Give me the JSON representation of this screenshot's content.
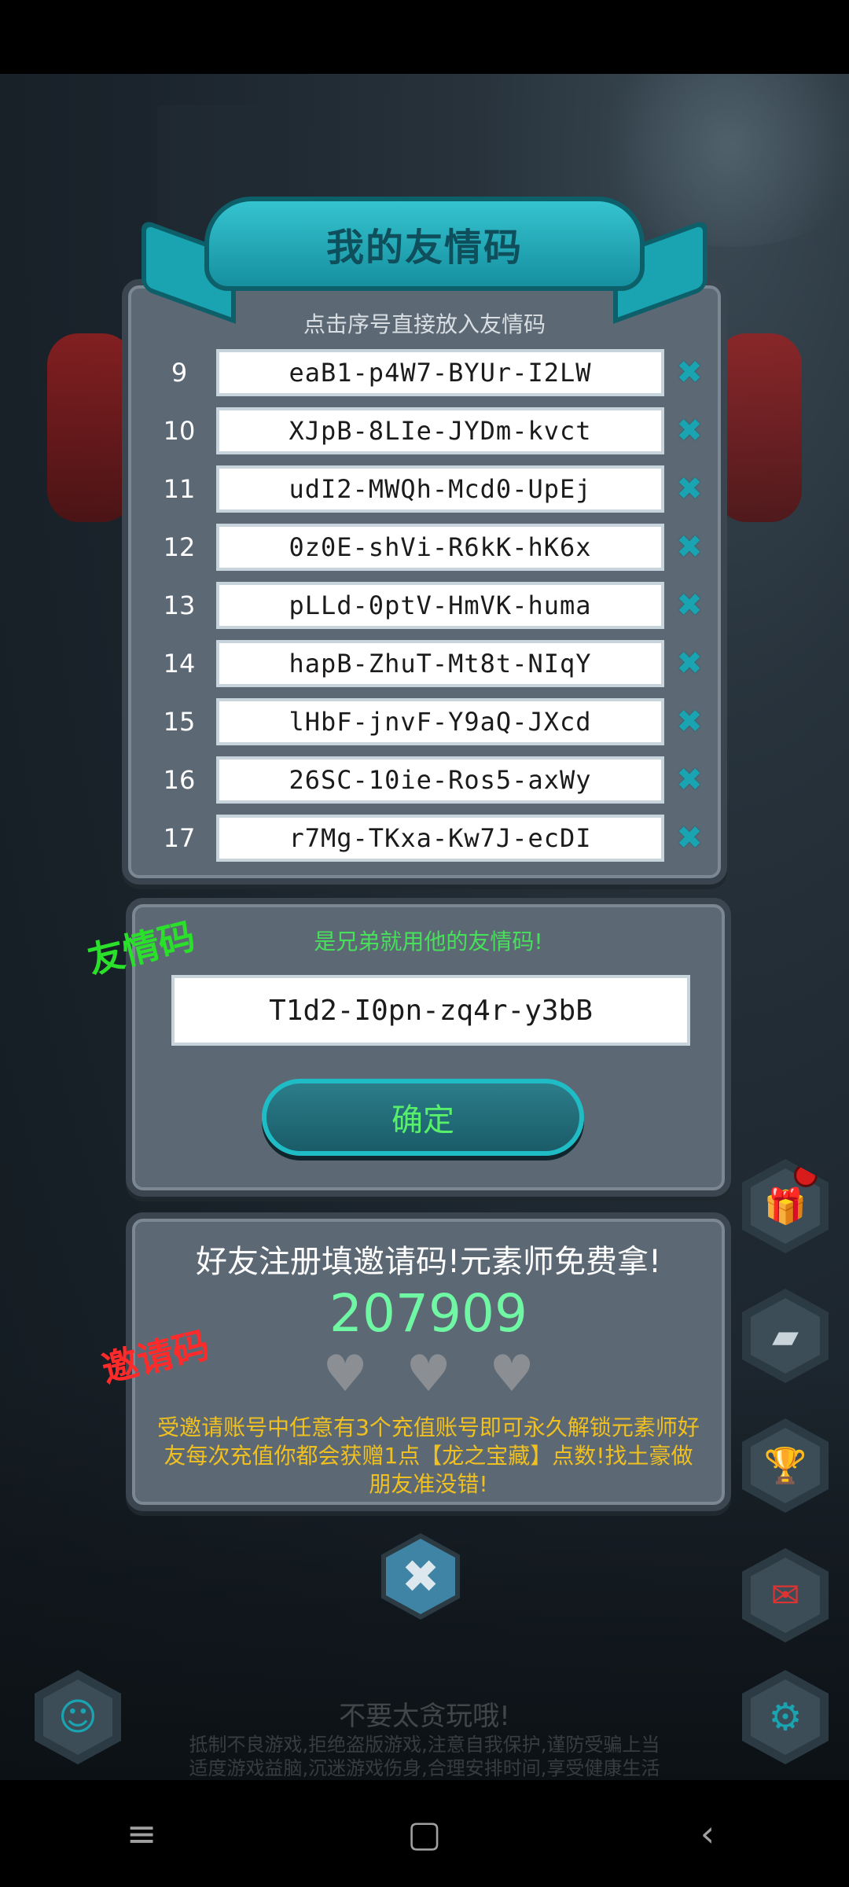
{
  "ribbon": {
    "title": "我的友情码"
  },
  "codes_panel": {
    "hint": "点击序号直接放入友情码",
    "rows": [
      {
        "num": "9",
        "code": "eaB1-p4W7-BYUr-I2LW"
      },
      {
        "num": "10",
        "code": "XJpB-8LIe-JYDm-kvct"
      },
      {
        "num": "11",
        "code": "udI2-MWQh-Mcd0-UpEj"
      },
      {
        "num": "12",
        "code": "0z0E-shVi-R6kK-hK6x"
      },
      {
        "num": "13",
        "code": "pLLd-0ptV-HmVK-huma"
      },
      {
        "num": "14",
        "code": "hapB-ZhuT-Mt8t-NIqY"
      },
      {
        "num": "15",
        "code": "lHbF-jnvF-Y9aQ-JXcd"
      },
      {
        "num": "16",
        "code": "26SC-10ie-Ros5-axWy"
      },
      {
        "num": "17",
        "code": "r7Mg-TKxa-Kw7J-ecDI"
      }
    ],
    "delete_icon": "close-x-icon"
  },
  "friend_panel": {
    "stamp": "友情码",
    "tip": "是兄弟就用他的友情码!",
    "input_value": "T1d2-I0pn-zq4r-y3bB",
    "confirm_label": "确定"
  },
  "invite_panel": {
    "stamp": "邀请码",
    "title": "好友注册填邀请码!元素师免费拿!",
    "code": "207909",
    "hearts": [
      "♥",
      "♥",
      "♥"
    ],
    "description": "受邀请账号中任意有3个充值账号即可永久解锁元素师好友每次充值你都会获赠1点【龙之宝藏】点数!找土豪做朋友准没错!"
  },
  "bottom_warning": {
    "title": "不要太贪玩哦!",
    "line1": "抵制不良游戏,拒绝盗版游戏,注意自我保护,谨防受骗上当",
    "line2": "适度游戏益脑,沉迷游戏伤身,合理安排时间,享受健康生活"
  },
  "close_button": {
    "symbol": "✖"
  },
  "nav": {
    "menu": "≡",
    "home": "▢",
    "back": "‹"
  },
  "colors": {
    "accent": "#1aa3b0",
    "confirm_text": "#58f06a",
    "invite_code": "#6ff7a4",
    "desc": "#f0c020"
  }
}
